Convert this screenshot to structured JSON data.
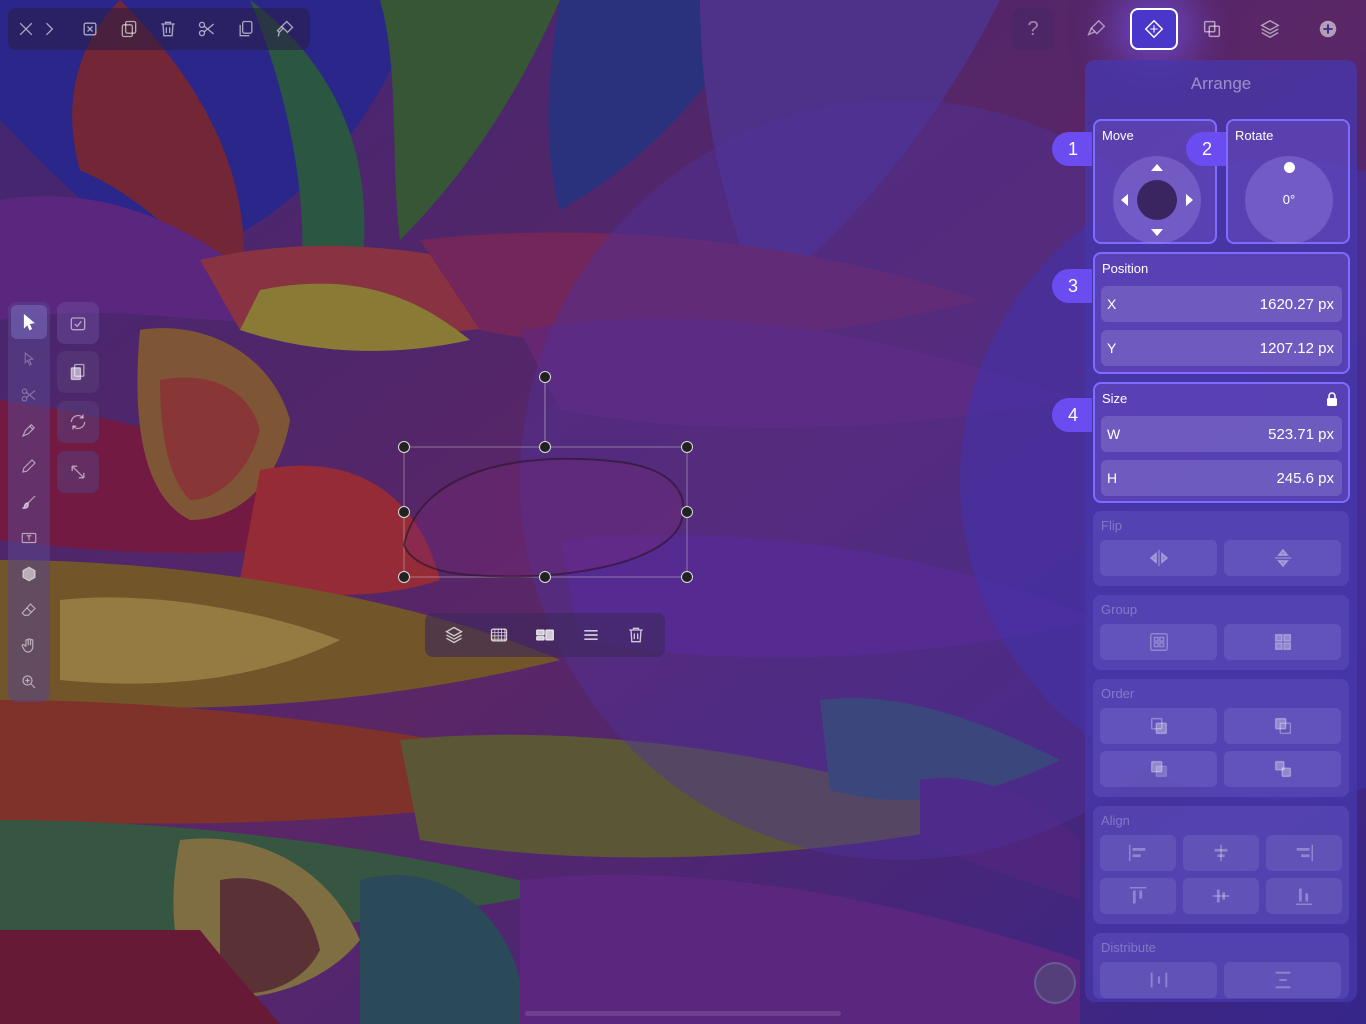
{
  "top_left_toolbar": {
    "icons": [
      "close-icon",
      "chevron-right-icon",
      "deselect-icon",
      "duplicate-icon",
      "trash-icon",
      "scissors-icon",
      "copy-icon",
      "paste-style-icon"
    ]
  },
  "top_right_toolbar": {
    "help_label": "?",
    "tabs": [
      "brush-settings-icon",
      "arrange-icon",
      "boolean-icon",
      "layers-icon",
      "add-icon"
    ],
    "active_tab": "arrange-icon"
  },
  "panel": {
    "title": "Arrange",
    "move": {
      "label": "Move",
      "badge": "1"
    },
    "rotate": {
      "label": "Rotate",
      "value": "0°",
      "badge": "2"
    },
    "position": {
      "label": "Position",
      "badge": "3",
      "x_label": "X",
      "x_value": "1620.27 px",
      "y_label": "Y",
      "y_value": "1207.12 px"
    },
    "size": {
      "label": "Size",
      "badge": "4",
      "w_label": "W",
      "w_value": "523.71 px",
      "h_label": "H",
      "h_value": "245.6 px",
      "locked": true
    },
    "flip": {
      "label": "Flip"
    },
    "group": {
      "label": "Group"
    },
    "order": {
      "label": "Order"
    },
    "align": {
      "label": "Align"
    },
    "distribute": {
      "label": "Distribute"
    }
  },
  "left_tools": [
    "select-icon",
    "node-icon",
    "scissors-icon",
    "pen-icon",
    "pencil-icon",
    "brush-icon",
    "text-icon",
    "shape-icon",
    "eraser-icon",
    "hand-icon",
    "zoom-icon"
  ],
  "active_tool": "select-icon",
  "colors": {
    "accent": "#6a4cf0",
    "panel": "#4637aa",
    "card_border": "#7d6cff"
  }
}
